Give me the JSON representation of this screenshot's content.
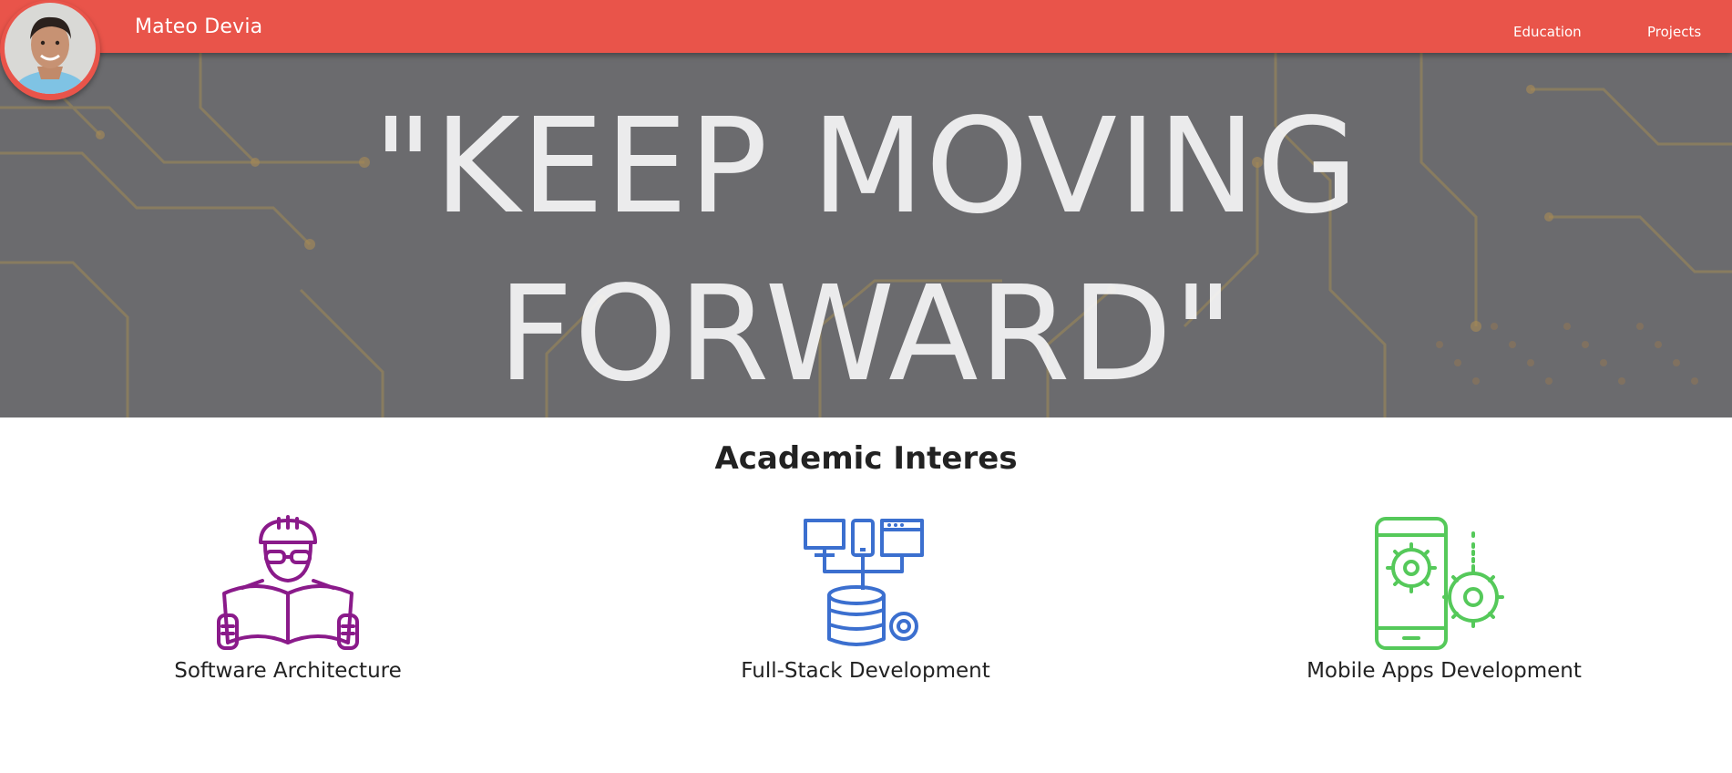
{
  "navbar": {
    "brand": "Mateo Devia",
    "links": [
      "Education",
      "Projects"
    ],
    "color": "#e9544a"
  },
  "hero": {
    "quote_line1": "\"KEEP MOVING",
    "quote_line2": "FORWARD\"",
    "background": "circuit-board"
  },
  "academic": {
    "title": "Academic Interes",
    "items": [
      {
        "label": "Software Architecture",
        "icon": "engineer-blueprint-icon",
        "color": "#8a1a8a"
      },
      {
        "label": "Full-Stack Development",
        "icon": "devices-database-icon",
        "color": "#3b6fcf"
      },
      {
        "label": "Mobile Apps Development",
        "icon": "mobile-gears-icon",
        "color": "#55c95a"
      }
    ]
  }
}
